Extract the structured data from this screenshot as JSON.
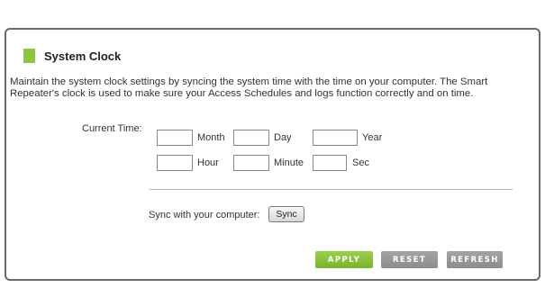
{
  "section": {
    "title": "System Clock",
    "description": "Maintain the system clock settings by syncing the system time with the time on your computer. The Smart Repeater's clock is used to make sure your Access Schedules and logs function correctly and on time.",
    "accent_color": "#8cc63f"
  },
  "clock": {
    "current_time_label": "Current Time:",
    "month": {
      "label": "Month",
      "value": ""
    },
    "day": {
      "label": "Day",
      "value": ""
    },
    "year": {
      "label": "Year",
      "value": ""
    },
    "hour": {
      "label": "Hour",
      "value": ""
    },
    "minute": {
      "label": "Minute",
      "value": ""
    },
    "sec": {
      "label": "Sec",
      "value": ""
    }
  },
  "sync": {
    "label": "Sync with your computer:",
    "button": "Sync"
  },
  "actions": {
    "apply": "APPLY",
    "reset": "RESET",
    "refresh": "REFRESH"
  }
}
